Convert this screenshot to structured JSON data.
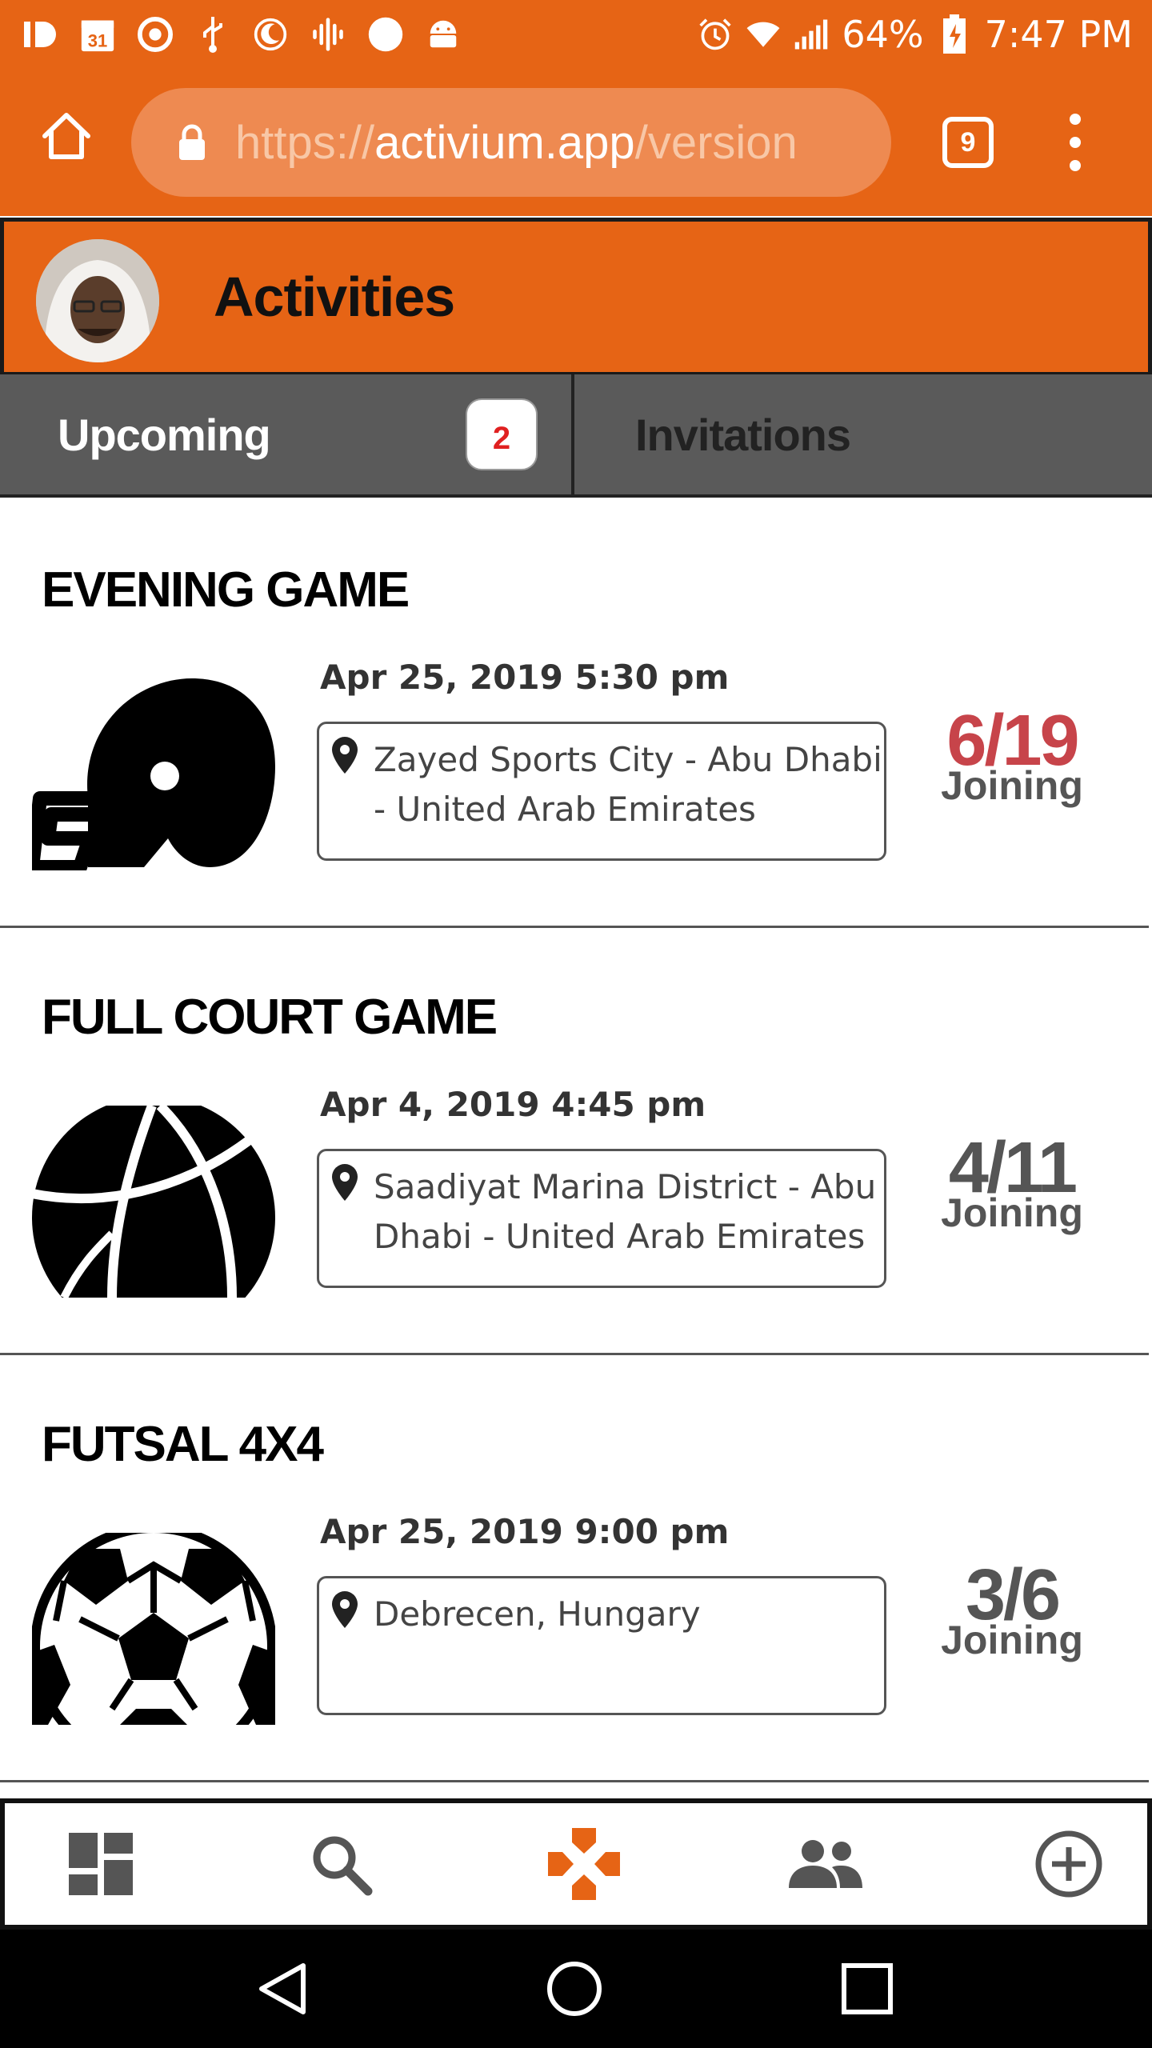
{
  "status_bar": {
    "battery": "64%",
    "time": "7:47 PM",
    "calendar_day": "31"
  },
  "browser": {
    "url_scheme": "https://",
    "url_host": "activium.app",
    "url_path": "/version",
    "tab_count": "9"
  },
  "header": {
    "title": "Activities"
  },
  "tabs": {
    "upcoming_label": "Upcoming",
    "upcoming_badge": "2",
    "invitations_label": "Invitations"
  },
  "activities": [
    {
      "title": "EVENING GAME",
      "date": "Apr 25, 2019 5:30 pm",
      "location": "Zayed Sports City - Abu Dhabi - United Arab Emirates",
      "count": "6/19",
      "count_label": "Joining",
      "count_color": "#c7444a",
      "icon": "football-helmet-icon"
    },
    {
      "title": "FULL COURT GAME",
      "date": "Apr 4, 2019 4:45 pm",
      "location": "Saadiyat Marina District - Abu Dhabi - United Arab Emirates",
      "count": "4/11",
      "count_label": "Joining",
      "count_color": "#555555",
      "icon": "basketball-icon"
    },
    {
      "title": "FUTSAL 4X4",
      "date": "Apr 25, 2019 9:00 pm",
      "location": "Debrecen, Hungary",
      "count": "3/6",
      "count_label": "Joining",
      "count_color": "#555555",
      "icon": "soccer-ball-icon"
    }
  ],
  "bottom_nav": {
    "active_item": "activities",
    "active_color": "#e66415",
    "inactive_color": "#555555"
  }
}
